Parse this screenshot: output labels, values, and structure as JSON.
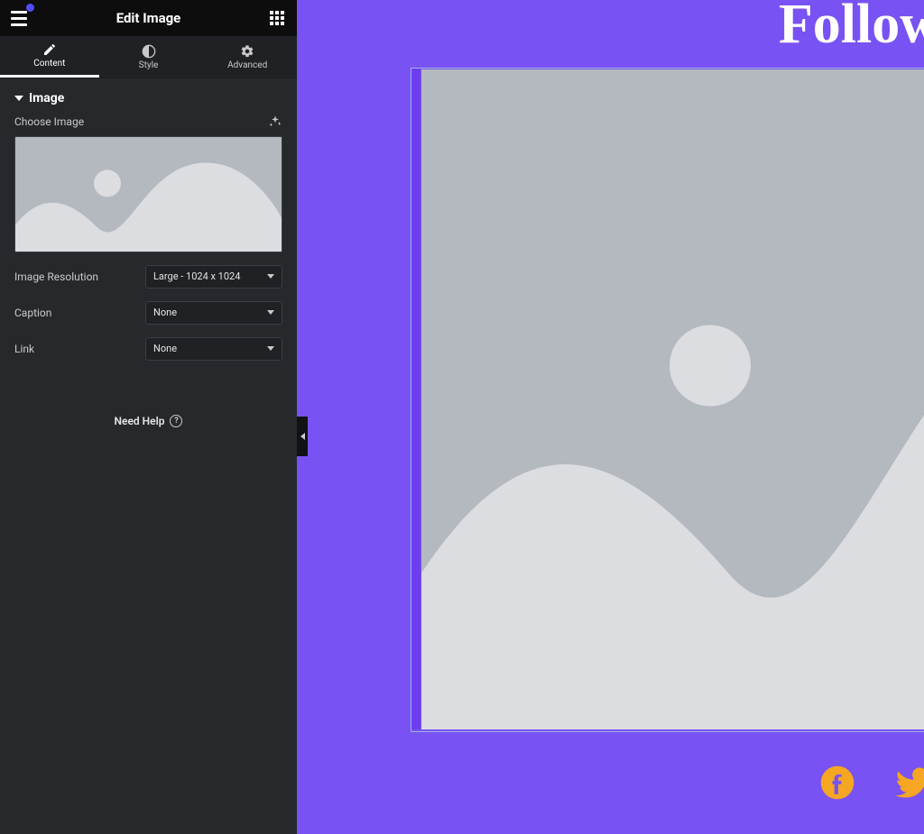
{
  "header": {
    "title": "Edit Image"
  },
  "tabs": {
    "content": "Content",
    "style": "Style",
    "advanced": "Advanced"
  },
  "section": {
    "title": "Image"
  },
  "controls": {
    "choose_image_label": "Choose Image",
    "resolution_label": "Image Resolution",
    "resolution_value": "Large - 1024 x 1024",
    "caption_label": "Caption",
    "caption_value": "None",
    "link_label": "Link",
    "link_value": "None"
  },
  "help": {
    "label": "Need Help"
  },
  "canvas": {
    "heading": "Follow"
  },
  "icons": {
    "facebook": "facebook-icon",
    "twitter": "twitter-icon"
  }
}
